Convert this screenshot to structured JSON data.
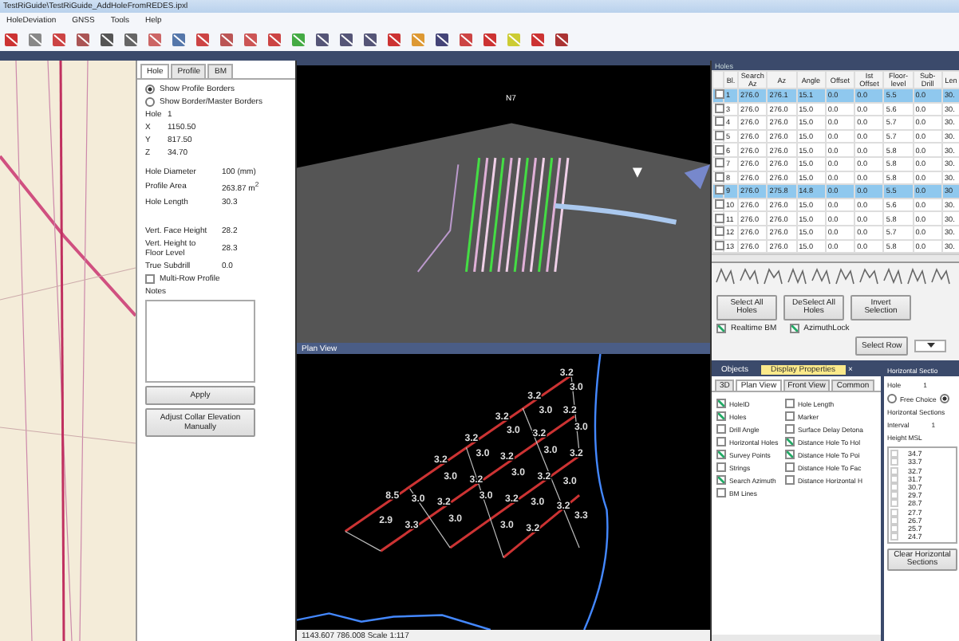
{
  "window": {
    "title": "TestRiGuide\\TestRiGuide_AddHoleFromREDES.ipxl"
  },
  "menu": [
    "HoleDeviation",
    "GNSS",
    "Tools",
    "Help"
  ],
  "left_panel": {
    "tabs": [
      {
        "label": "Hole",
        "selected": true
      },
      {
        "label": "Profile",
        "selected": false
      },
      {
        "label": "BM",
        "selected": false
      }
    ],
    "radios": [
      {
        "label": "Show Profile Borders",
        "selected": true
      },
      {
        "label": "Show Border/Master Borders",
        "selected": false
      }
    ],
    "coords": [
      {
        "label": "Hole",
        "value": "1"
      },
      {
        "label": "X",
        "value": "1150.50"
      },
      {
        "label": "Y",
        "value": "817.50"
      },
      {
        "label": "Z",
        "value": "34.70"
      }
    ],
    "metrics": [
      {
        "label": "Hole Diameter",
        "value": "100 (mm)"
      },
      {
        "label": "Profile Area",
        "value": "263.87 m$^{2}$"
      },
      {
        "label": "Hole Length",
        "value": "30.3"
      }
    ],
    "heights": [
      {
        "label": "Vert. Face Height",
        "value": "28.2"
      },
      {
        "label": "Vert. Height to Floor Level",
        "value": "28.3"
      },
      {
        "label": "True Subdrill",
        "value": "0.0"
      }
    ],
    "multi_row": {
      "label": "Multi-Row Profile",
      "checked": false
    },
    "notes_label": "Notes",
    "buttons": [
      "Apply",
      "Adjust Collar Elevation Manually"
    ]
  },
  "view_3d": {
    "label": "N7"
  },
  "plan_view": {
    "title": "Plan View",
    "labels": [
      "3.2",
      "3.0",
      "3.2",
      "3.0",
      "3.2",
      "3.0",
      "3.2",
      "3.0",
      "3.2",
      "3.0",
      "3.2",
      "3.2",
      "3.0",
      "3.2",
      "3.0",
      "3.2",
      "3.0",
      "3.2",
      "3.0",
      "3.2",
      "3.0",
      "3.2",
      "3.0",
      "3.2",
      "8.5",
      "3.0",
      "3.2",
      "3.0",
      "3.0",
      "3.2",
      "2.9",
      "3.3",
      "3.3"
    ],
    "status": "1143.607   786.008   Scale 1:117"
  },
  "holes": {
    "title": "Holes",
    "columns": [
      "Bl.",
      "Search Az",
      "Az",
      "Angle",
      "Offset",
      "Ist Offset",
      "Floor-level",
      "Sub-Drill",
      "Len"
    ],
    "rows": [
      {
        "checked": false,
        "selected": true,
        "cells": [
          "1",
          "276.0",
          "276.1",
          "15.1",
          "0.0",
          "0.0",
          "5.5",
          "0.0",
          "30."
        ]
      },
      {
        "checked": false,
        "selected": false,
        "cells": [
          "3",
          "276.0",
          "276.0",
          "15.0",
          "0.0",
          "0.0",
          "5.6",
          "0.0",
          "30."
        ]
      },
      {
        "checked": false,
        "selected": false,
        "cells": [
          "4",
          "276.0",
          "276.0",
          "15.0",
          "0.0",
          "0.0",
          "5.7",
          "0.0",
          "30."
        ]
      },
      {
        "checked": false,
        "selected": false,
        "cells": [
          "5",
          "276.0",
          "276.0",
          "15.0",
          "0.0",
          "0.0",
          "5.7",
          "0.0",
          "30."
        ]
      },
      {
        "checked": false,
        "selected": false,
        "cells": [
          "6",
          "276.0",
          "276.0",
          "15.0",
          "0.0",
          "0.0",
          "5.8",
          "0.0",
          "30."
        ]
      },
      {
        "checked": false,
        "selected": false,
        "cells": [
          "7",
          "276.0",
          "276.0",
          "15.0",
          "0.0",
          "0.0",
          "5.8",
          "0.0",
          "30."
        ]
      },
      {
        "checked": false,
        "selected": false,
        "cells": [
          "8",
          "276.0",
          "276.0",
          "15.0",
          "0.0",
          "0.0",
          "5.8",
          "0.0",
          "30."
        ]
      },
      {
        "checked": false,
        "selected": true,
        "cells": [
          "9",
          "276.0",
          "275.8",
          "14.8",
          "0.0",
          "0.0",
          "5.5",
          "0.0",
          "30"
        ]
      },
      {
        "checked": false,
        "selected": false,
        "cells": [
          "10",
          "276.0",
          "276.0",
          "15.0",
          "0.0",
          "0.0",
          "5.6",
          "0.0",
          "30."
        ]
      },
      {
        "checked": false,
        "selected": false,
        "cells": [
          "11",
          "276.0",
          "276.0",
          "15.0",
          "0.0",
          "0.0",
          "5.8",
          "0.0",
          "30."
        ]
      },
      {
        "checked": false,
        "selected": false,
        "cells": [
          "12",
          "276.0",
          "276.0",
          "15.0",
          "0.0",
          "0.0",
          "5.7",
          "0.0",
          "30."
        ]
      },
      {
        "checked": false,
        "selected": false,
        "cells": [
          "13",
          "276.0",
          "276.0",
          "15.0",
          "0.0",
          "0.0",
          "5.8",
          "0.0",
          "30."
        ]
      }
    ],
    "buttons": [
      "Select All Holes",
      "DeSelect All Holes",
      "Invert Selection"
    ],
    "options": [
      {
        "label": "Realtime BM",
        "checked": true
      },
      {
        "label": "AzimuthLock",
        "checked": true
      }
    ],
    "select_row": "Select Row"
  },
  "display": {
    "tabs": [
      {
        "label": "Objects",
        "selected": false
      },
      {
        "label": "Display Properties",
        "selected": true
      }
    ],
    "close": "×",
    "view_tabs": [
      {
        "label": "3D",
        "selected": false
      },
      {
        "label": "Plan View",
        "selected": true
      },
      {
        "label": "Front View",
        "selected": false
      },
      {
        "label": "Common",
        "selected": false
      }
    ],
    "options": [
      {
        "label": "HoleID",
        "checked": true
      },
      {
        "label": "Holes",
        "checked": true
      },
      {
        "label": "Drill Angle",
        "checked": false
      },
      {
        "label": "Horizontal Holes",
        "checked": false
      },
      {
        "label": "Survey Points",
        "checked": true
      },
      {
        "label": "Strings",
        "checked": false
      },
      {
        "label": "Search Azimuth",
        "checked": true
      },
      {
        "label": "BM Lines",
        "checked": false
      },
      {
        "label": "Hole Length",
        "checked": false
      },
      {
        "label": "Marker",
        "checked": false
      },
      {
        "label": "Surface Delay Detona",
        "checked": false
      },
      {
        "label": "Distance Hole To Hol",
        "checked": true
      },
      {
        "label": "Distance Hole To Poi",
        "checked": true
      },
      {
        "label": "Distance Hole To Fac",
        "checked": false
      },
      {
        "label": "Distance Horizontal H",
        "checked": false
      }
    ]
  },
  "sections": {
    "title": "Horizontal Sectio",
    "hole_label": "Hole",
    "hole_value": "1",
    "radios": [
      {
        "label": "Free Choice",
        "selected": false
      },
      {
        "selected": true
      }
    ],
    "sections_label": "Horizontal Sections",
    "interval_label": "Interval",
    "interval_value": "1",
    "column": "Height MSL",
    "heights": [
      "34.7",
      "33.7",
      "32.7",
      "31.7",
      "30.7",
      "29.7",
      "28.7",
      "27.7",
      "26.7",
      "25.7",
      "24.7"
    ],
    "button": "Clear Horizontal Sections"
  }
}
